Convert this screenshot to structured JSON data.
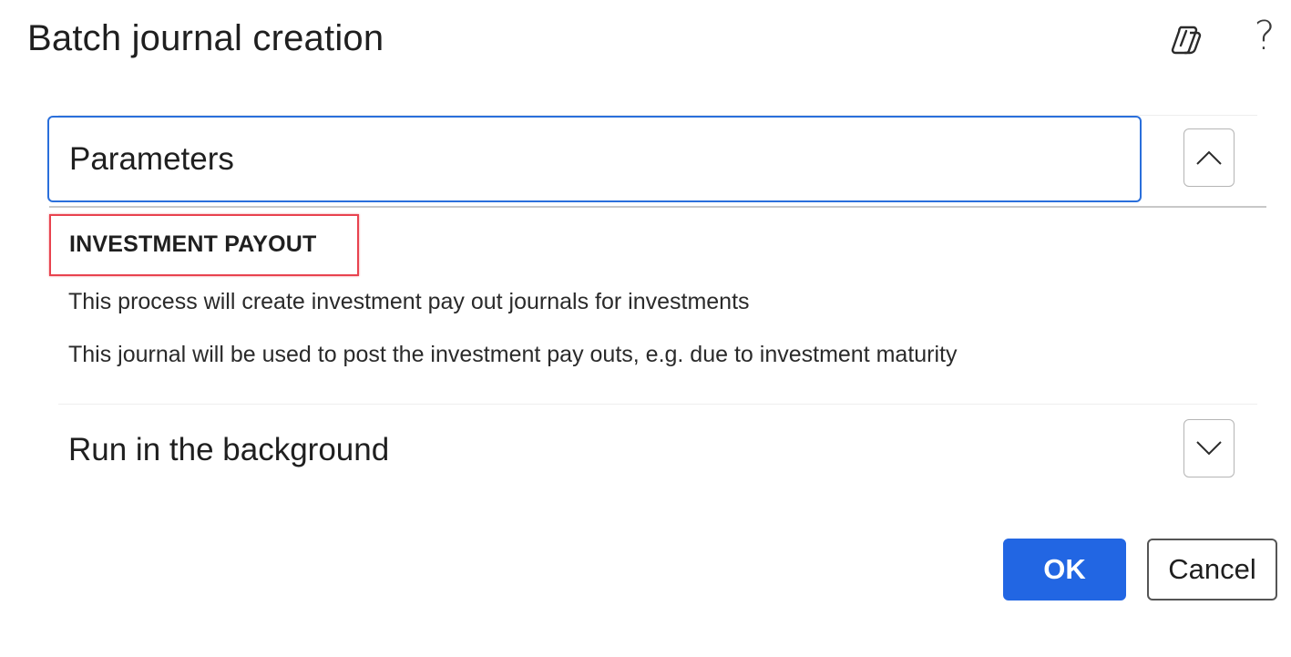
{
  "dialog": {
    "title": "Batch journal creation",
    "icons": {
      "copilot": "copilot-icon",
      "help": "?"
    }
  },
  "sections": {
    "parameters": {
      "title": "Parameters",
      "expanded": true,
      "group_label": "INVESTMENT PAYOUT",
      "descriptions": [
        "This process will create investment pay out journals for investments",
        "This journal will be used to post the investment pay outs, e.g. due to investment maturity"
      ]
    },
    "background": {
      "title": "Run in the background",
      "expanded": false
    }
  },
  "buttons": {
    "ok": "OK",
    "cancel": "Cancel"
  },
  "colors": {
    "accent": "#2266e3",
    "focus_border": "#2a6fdb",
    "highlight": "#e8434f"
  }
}
